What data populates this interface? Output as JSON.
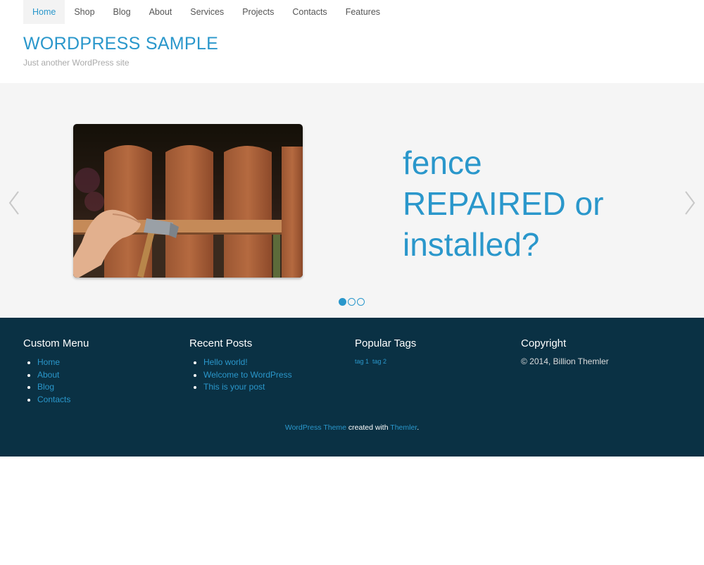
{
  "nav": {
    "items": [
      {
        "label": "Home",
        "active": true
      },
      {
        "label": "Shop"
      },
      {
        "label": "Blog"
      },
      {
        "label": "About"
      },
      {
        "label": "Services"
      },
      {
        "label": "Projects"
      },
      {
        "label": "Contacts"
      },
      {
        "label": "Features"
      }
    ]
  },
  "header": {
    "title": "WORDPRESS SAMPLE",
    "tagline": "Just another WordPress site"
  },
  "slider": {
    "text_lines": [
      "fence",
      "REPAIRED or",
      "installed?"
    ],
    "prev_icon": "chevron-left-icon",
    "next_icon": "chevron-right-icon",
    "dots_count": 3,
    "active_dot": 1
  },
  "footer": {
    "custom_menu": {
      "title": "Custom Menu",
      "items": [
        "Home",
        "About",
        "Blog",
        "Contacts"
      ]
    },
    "recent_posts": {
      "title": "Recent Posts",
      "items": [
        "Hello world!",
        "Welcome to WordPress",
        "This is your post"
      ]
    },
    "popular_tags": {
      "title": "Popular Tags",
      "items": [
        "tag 1",
        "tag 2"
      ]
    },
    "copyright": {
      "title": "Copyright",
      "text": "© 2014, Billion Themler"
    },
    "credit": {
      "link1": "WordPress Theme",
      "middle": " created with ",
      "link2": "Themler",
      "end": "."
    }
  },
  "colors": {
    "accent": "#2a97cb",
    "footer_bg": "#0a3144",
    "slider_bg": "#f5f5f5"
  }
}
